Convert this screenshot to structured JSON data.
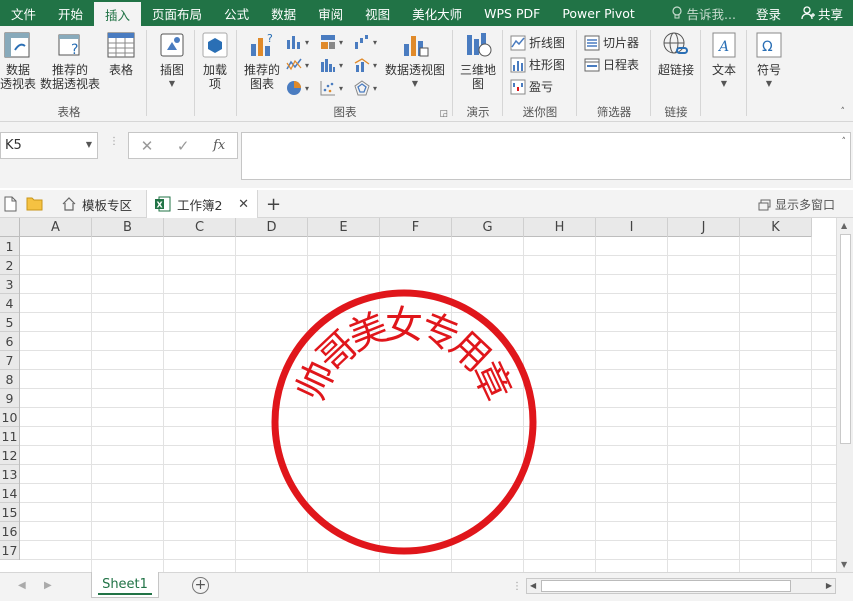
{
  "menu": {
    "tabs": [
      "文件",
      "开始",
      "插入",
      "页面布局",
      "公式",
      "数据",
      "审阅",
      "视图",
      "美化大师",
      "WPS PDF",
      "Power Pivot"
    ],
    "active_index": 2,
    "tell_me": "告诉我...",
    "login": "登录",
    "share": "共享"
  },
  "ribbon": {
    "tables": {
      "label": "表格",
      "pivot": "数据\n透视表",
      "recommended_pivot": "推荐的\n数据透视表",
      "table": "表格"
    },
    "illustrations": {
      "label": "插图"
    },
    "addins": {
      "label": "加载\n项"
    },
    "charts": {
      "label": "图表",
      "recommended": "推荐的\n图表",
      "pivot_chart": "数据透视图"
    },
    "tours": {
      "label": "演示",
      "map3d": "三维地\n图"
    },
    "sparklines": {
      "label": "迷你图",
      "line": "折线图",
      "column": "柱形图",
      "winloss": "盈亏"
    },
    "filters": {
      "label": "筛选器",
      "slicer": "切片器",
      "timeline": "日程表"
    },
    "links": {
      "label": "链接",
      "hyperlink": "超链接"
    },
    "text": {
      "label": "文本"
    },
    "symbols": {
      "label": "符号"
    }
  },
  "formula_bar": {
    "name_box": "K5",
    "formula": ""
  },
  "workbook_tabs": {
    "template_zone": "模板专区",
    "active": "工作簿2",
    "multi_window": "显示多窗口"
  },
  "columns": [
    "A",
    "B",
    "C",
    "D",
    "E",
    "F",
    "G",
    "H",
    "I",
    "J",
    "K"
  ],
  "rows": [
    "1",
    "2",
    "3",
    "4",
    "5",
    "6",
    "7",
    "8",
    "9",
    "10",
    "11",
    "12",
    "13",
    "14",
    "15",
    "16",
    "17"
  ],
  "seal": {
    "text": "帅哥美女专用章",
    "color": "#e0161b"
  },
  "sheets": {
    "active": "Sheet1"
  },
  "colors": {
    "accent": "#217346"
  }
}
